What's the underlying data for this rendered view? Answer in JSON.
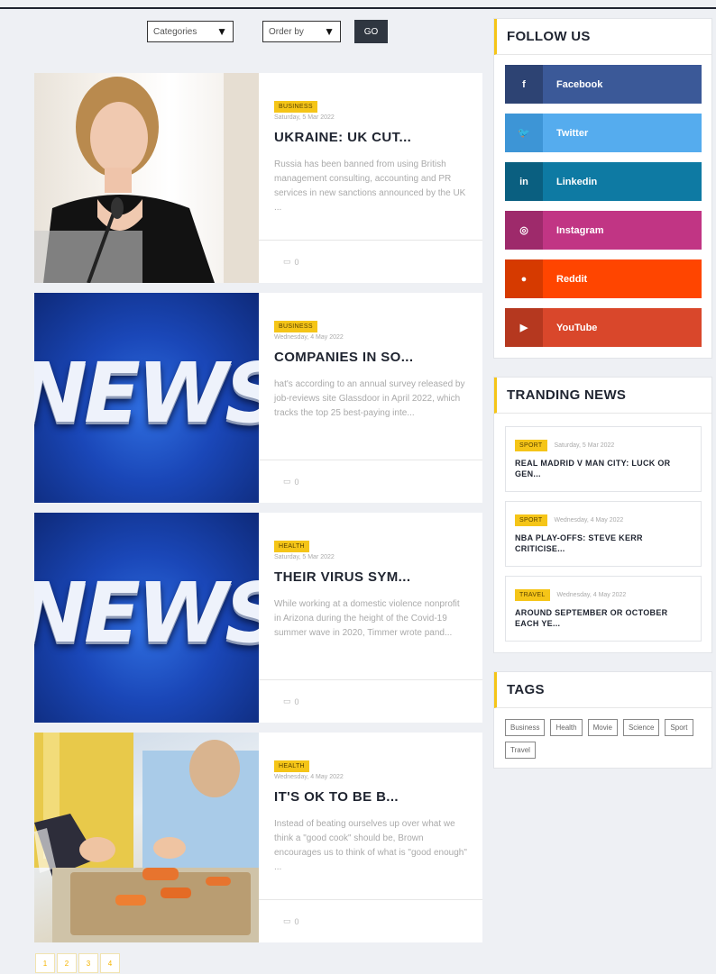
{
  "filters": {
    "categories_label": "Categories",
    "order_label": "Order by",
    "go_label": "GO"
  },
  "articles": [
    {
      "category": "BUSINESS",
      "date": "Saturday, 5 Mar 2022",
      "title": "UKRAINE: UK CUT...",
      "excerpt": "Russia has been banned from using British management consulting, accounting and PR services in new sanctions announced by the UK ...",
      "comments": "0",
      "image": "portrait-photo"
    },
    {
      "category": "BUSINESS",
      "date": "Wednesday, 4 May 2022",
      "title": "COMPANIES IN SO...",
      "excerpt": "hat's according to an annual survey released by job-reviews site Glassdoor in April 2022, which tracks the top 25 best-paying inte...",
      "comments": "0",
      "image": "news-graphic",
      "image_text": "NEWS"
    },
    {
      "category": "HEALTH",
      "date": "Saturday, 5 Mar 2022",
      "title": "THEIR VIRUS SYM...",
      "excerpt": "While working at a domestic violence nonprofit in Arizona during the height of the Covid-19 summer wave in 2020, Timmer wrote pand...",
      "comments": "0",
      "image": "news-graphic",
      "image_text": "NEWS"
    },
    {
      "category": "HEALTH",
      "date": "Wednesday, 4 May 2022",
      "title": "IT'S OK TO BE B...",
      "excerpt": "Instead of beating ourselves up over what we think a \"good cook\" should be, Brown encourages us to think of what is \"good enough\" ...",
      "comments": "0",
      "image": "cooking-photo"
    }
  ],
  "pagination": [
    "1",
    "2",
    "3",
    "4"
  ],
  "sidebar": {
    "follow_title": "FOLLOW US",
    "socials": [
      {
        "icon_text": "f",
        "label": "Facebook",
        "color": "#3b5998",
        "icon_color": "#2d4373",
        "icon": "facebook-icon"
      },
      {
        "icon_text": "🐦",
        "label": "Twitter",
        "color": "#55acee",
        "icon_color": "#3d95d6",
        "icon": "twitter-icon"
      },
      {
        "icon_text": "in",
        "label": "Linkedin",
        "color": "#0e7aa3",
        "icon_color": "#0a5f80",
        "icon": "linkedin-icon"
      },
      {
        "icon_text": "◎",
        "label": "Instagram",
        "color": "#c13584",
        "icon_color": "#9e2a6b",
        "icon": "instagram-icon"
      },
      {
        "icon_text": "●",
        "label": "Reddit",
        "color": "#ff4500",
        "icon_color": "#d63a00",
        "icon": "reddit-icon"
      },
      {
        "icon_text": "▶",
        "label": "YouTube",
        "color": "#d9472b",
        "icon_color": "#b5381f",
        "icon": "youtube-icon"
      }
    ],
    "trending_title": "TRANDING NEWS",
    "trending": [
      {
        "category": "SPORT",
        "date": "Saturday, 5 Mar 2022",
        "title": "REAL MADRID V MAN CITY: LUCK OR GEN..."
      },
      {
        "category": "SPORT",
        "date": "Wednesday, 4 May 2022",
        "title": "NBA PLAY-OFFS: STEVE KERR CRITICISE..."
      },
      {
        "category": "TRAVEL",
        "date": "Wednesday, 4 May 2022",
        "title": "AROUND SEPTEMBER OR OCTOBER EACH YE..."
      }
    ],
    "tags_title": "TAGS",
    "tags": [
      "Business",
      "Health",
      "Movie",
      "Science",
      "Sport",
      "Travel"
    ]
  },
  "colors": {
    "accent": "#f5c518",
    "dark": "#1f2430"
  }
}
